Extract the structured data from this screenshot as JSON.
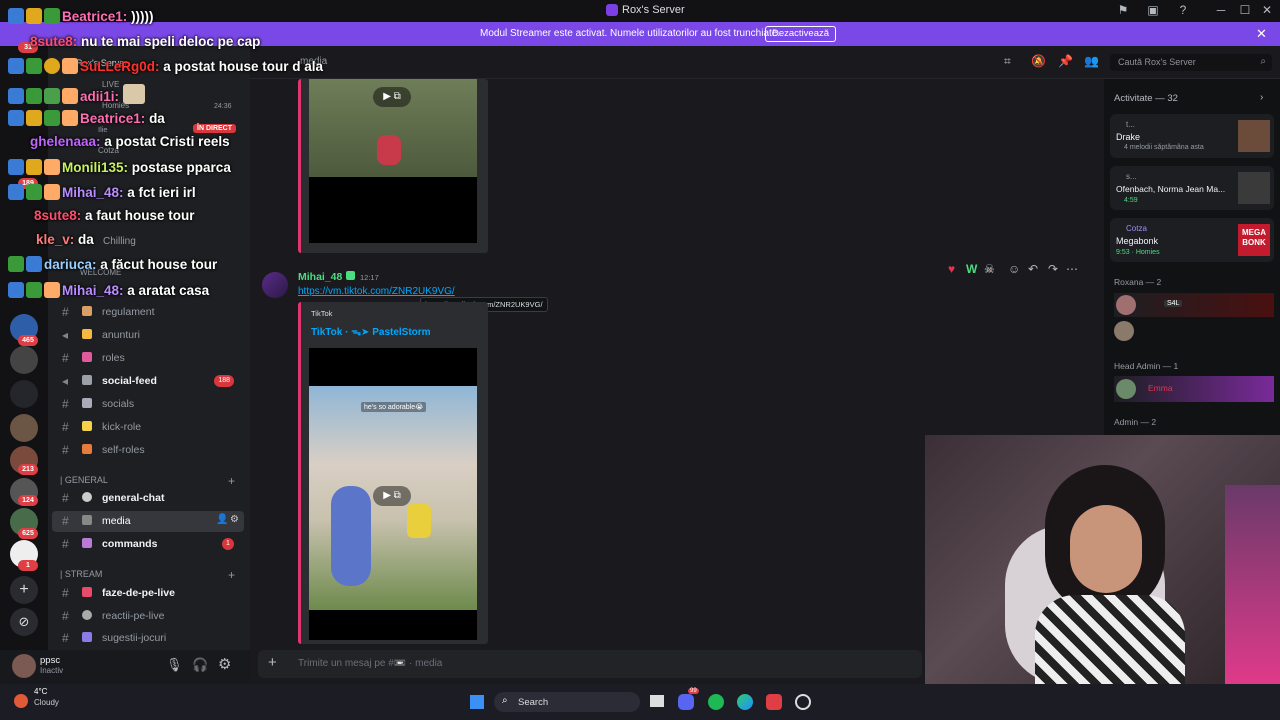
{
  "window": {
    "title": "Rox's Server",
    "minimize": "─",
    "maximize": "☐",
    "close": "✕"
  },
  "banner": {
    "text": "Modul Streamer este activat. Numele utilizatorilor au fost trunchiate.",
    "button": "Dezactivează",
    "close": "✕"
  },
  "server_badges": [
    "31",
    "189",
    "465",
    "213",
    "124",
    "625",
    "1"
  ],
  "server_header": {
    "name": "Rox's Server",
    "live_label": "LIVE",
    "room": "Homies",
    "time": "24:36",
    "in_direct": "ÎN DIRECT",
    "member1": "Ilie",
    "member2": "Cotza",
    "chilling": "Chilling",
    "welcome": "WELCOME"
  },
  "channels": [
    {
      "name": "regulament",
      "badge": ""
    },
    {
      "name": "anunturi",
      "badge": ""
    },
    {
      "name": "roles",
      "badge": ""
    },
    {
      "name": "social-feed",
      "badge": "188"
    },
    {
      "name": "socials",
      "badge": ""
    },
    {
      "name": "kick-role",
      "badge": ""
    },
    {
      "name": "self-roles",
      "badge": ""
    }
  ],
  "category_general": "| GENERAL",
  "channels_general": [
    {
      "name": "general-chat",
      "badge": ""
    },
    {
      "name": "media",
      "badge": ""
    },
    {
      "name": "commands",
      "badge": "1"
    }
  ],
  "category_stream": "| STREAM",
  "channels_stream": [
    {
      "name": "faze-de-pe-live",
      "badge": ""
    },
    {
      "name": "reactii-pe-live",
      "badge": ""
    },
    {
      "name": "sugestii-jocuri",
      "badge": ""
    }
  ],
  "user": {
    "name": "ppsc",
    "status": "Inactiv"
  },
  "channel_header": {
    "name": "media"
  },
  "search": {
    "placeholder": "Caută Rox's Server"
  },
  "message": {
    "author": "Mihai_48",
    "time": "12:17",
    "link": "https://vm.tiktok.com/ZNR2UK9VG/",
    "tooltip": "https://vm.tiktok.com/ZNR2UK9VG/",
    "provider": "TikTok",
    "embed_title": "TikTok · ᯓ➤ PastelStorm",
    "video_caption": "he's so adorable😭"
  },
  "composer": {
    "placeholder": "Trimite un mesaj pe #📼 · media"
  },
  "sidebar": {
    "activity_header": "Activitate — 32",
    "activity": [
      {
        "user": "t...",
        "title": "Drake",
        "sub": "4 melodii săptămâna asta"
      },
      {
        "user": "s...",
        "title": "Ofenbach, Norma Jean Ma...",
        "sub": "4:59"
      },
      {
        "user": "Cotza",
        "title": "Megabonk",
        "sub": "9:53 · Homies",
        "cover": "MEGA BONK"
      }
    ],
    "group1": "Roxana — 2",
    "group1_tag": "S4L",
    "group2": "Head Admin — 1",
    "group2_member": "Emma",
    "group3": "Admin — 2"
  },
  "chat_overlay": [
    {
      "user": "Beatrice1:",
      "msg": ")))))",
      "color": "#ff6eb4"
    },
    {
      "user": "8sute8:",
      "msg": "nu te mai speli deloc pe cap",
      "color": "#ff4d6d"
    },
    {
      "user": "SuLLeRg0d:",
      "msg": "a postat house tour d ala",
      "color": "#ff3030"
    },
    {
      "user": "adii1i:",
      "msg": "",
      "color": "#ff6eb4"
    },
    {
      "user": "Beatrice1:",
      "msg": "da",
      "color": "#ff6eb4"
    },
    {
      "user": "ghelenaaa:",
      "msg": "a postat Cristi reels",
      "color": "#c065ff"
    },
    {
      "user": "Monili135:",
      "msg": "postase pparca",
      "color": "#c8f060"
    },
    {
      "user": "Mihai_48:",
      "msg": "a fct ieri irl",
      "color": "#b98cff"
    },
    {
      "user": "8sute8:",
      "msg": "a faut house tour",
      "color": "#ff4d6d"
    },
    {
      "user": "kle_v:",
      "msg": "da",
      "color": "#ff7a7a"
    },
    {
      "user": "dariuca:",
      "msg": "a făcut house tour",
      "color": "#9ad0ff"
    },
    {
      "user": "Mihai_48:",
      "msg": "a aratat casa",
      "color": "#b98cff"
    }
  ],
  "taskbar": {
    "temp": "4°C",
    "weather": "Cloudy",
    "search": "Search",
    "discord_badge": "99"
  },
  "colors": {
    "accent": "#7b48e8",
    "embed_border": "#e0356f",
    "author": "#4ade80"
  }
}
